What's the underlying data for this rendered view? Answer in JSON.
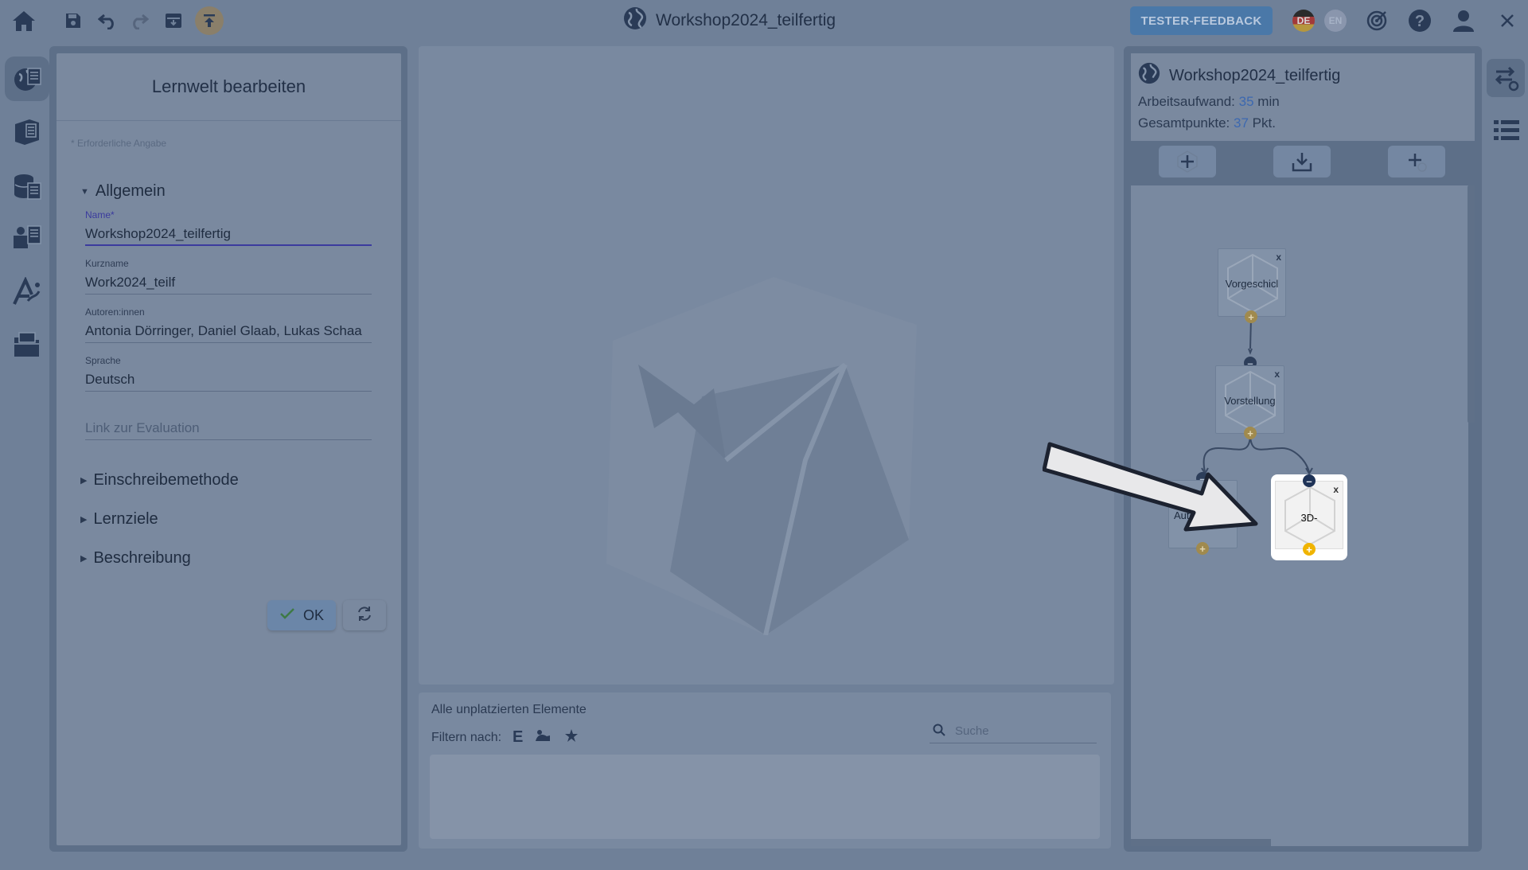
{
  "app": {
    "title": "Workshop2024_teilfertig",
    "feedback_label": "TESTER-FEEDBACK",
    "lang_de": "DE",
    "lang_en": "EN"
  },
  "toolbar": {
    "icons": [
      "home-icon",
      "save-icon",
      "undo-icon",
      "redo-icon",
      "archive-icon",
      "export-icon"
    ]
  },
  "topright": {
    "icons": [
      "target-icon",
      "help-icon",
      "user-icon",
      "close-icon"
    ]
  },
  "left_rail": {
    "icons": [
      "learning-world-icon",
      "learning-space-icon",
      "content-icon",
      "element-icon",
      "adaptivity-icon",
      "folder-icon"
    ]
  },
  "edit_panel": {
    "heading": "Lernwelt bearbeiten",
    "required_note": "* Erforderliche Angabe",
    "section_general": "Allgemein",
    "fields": {
      "name_label": "Name*",
      "name_value": "Workshop2024_teilfertig",
      "shortname_label": "Kurzname",
      "shortname_value": "Work2024_teilf",
      "authors_label": "Autoren:innen",
      "authors_value": "Antonia Dörringer, Daniel Glaab, Lukas Schaa",
      "language_label": "Sprache",
      "language_value": "Deutsch",
      "evaluation_placeholder": "Link zur Evaluation"
    },
    "sections": [
      "Einschreibemethode",
      "Lernziele",
      "Beschreibung"
    ],
    "ok_label": "OK"
  },
  "unplaced": {
    "title": "Alle unplatzierten Elemente",
    "filter_label": "Filtern nach:",
    "filter_e": "E",
    "search_placeholder": "Suche"
  },
  "world_panel": {
    "title": "Workshop2024_teilfertig",
    "workload_label": "Arbeitsaufwand:",
    "workload_value": "35",
    "workload_unit": "min",
    "points_label": "Gesamtpunkte:",
    "points_value": "37",
    "points_unit": "Pkt."
  },
  "nodes": {
    "n1": "Vorgeschicl",
    "n2": "Vorstellung",
    "n3": "Autor",
    "n4": "3D-",
    "close": "x"
  },
  "colors": {
    "overlay": "#6f8098",
    "accent_blue": "#3c68b0",
    "feedback_bg": "#4a78a8",
    "plus_dot": "#a08a4e",
    "minus_dot": "#2d3e5a",
    "highlight": "#ffffff"
  }
}
